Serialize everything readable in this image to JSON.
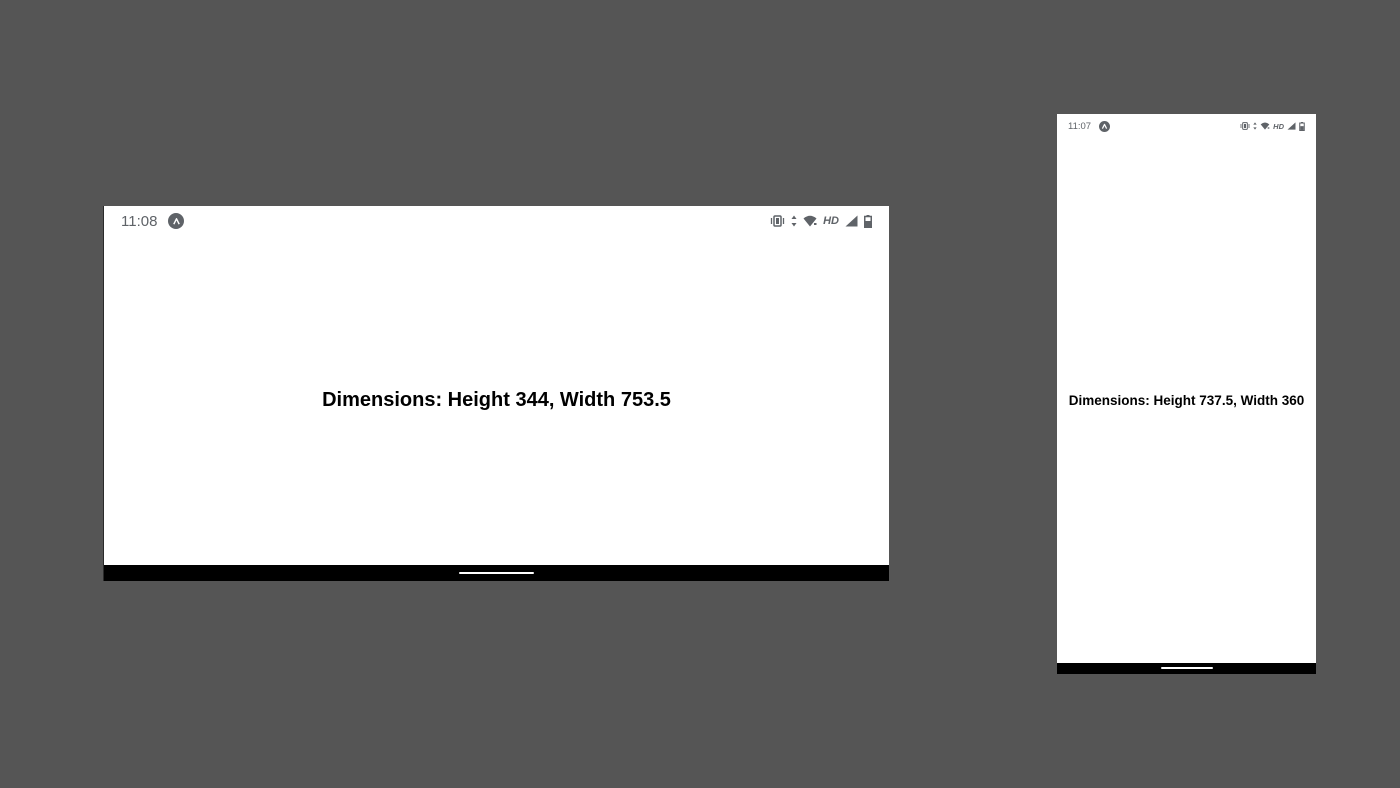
{
  "background_color": "#555555",
  "landscape_device": {
    "status_bar": {
      "time": "11:08",
      "app_icon": "arrow-up-icon",
      "network_label": "HD",
      "icons": [
        "vibrate-icon",
        "data-activity-icon",
        "wifi-icon",
        "hd-label",
        "cell-signal-icon",
        "battery-icon"
      ]
    },
    "content_text": "Dimensions: Height 344, Width 753.5"
  },
  "portrait_device": {
    "status_bar": {
      "time": "11:07",
      "app_icon": "arrow-up-icon",
      "network_label": "HD",
      "icons": [
        "vibrate-icon",
        "data-activity-icon",
        "wifi-icon",
        "hd-label",
        "cell-signal-icon",
        "battery-icon"
      ]
    },
    "content_text": "Dimensions: Height 737.5, Width 360"
  }
}
